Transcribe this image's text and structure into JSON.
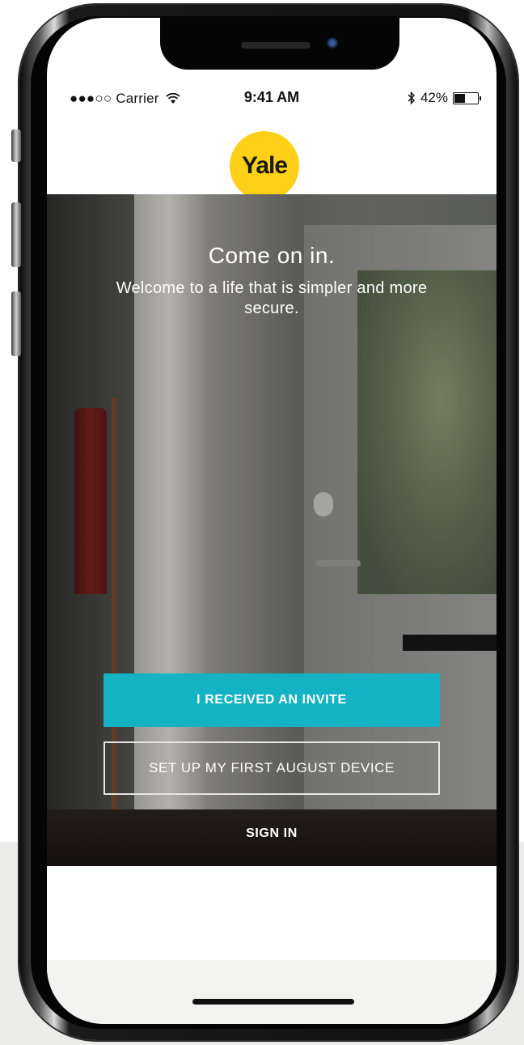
{
  "status_bar": {
    "carrier": "●●●○○ Carrier",
    "time": "9:41 AM",
    "battery": "42%"
  },
  "brand": {
    "logo_text": "Yale",
    "color": "#ffd018"
  },
  "welcome": {
    "headline": "Come on in.",
    "subheadline": "Welcome to a life that is simpler and more secure."
  },
  "actions": {
    "invite_label": "I RECEIVED AN INVITE",
    "setup_label": "SET UP MY FIRST AUGUST DEVICE",
    "signin_label": "SIGN IN",
    "accent": "#14b3c4"
  },
  "icons": {
    "wifi": "wifi-icon",
    "bluetooth": "bluetooth-icon",
    "battery": "battery-icon"
  }
}
